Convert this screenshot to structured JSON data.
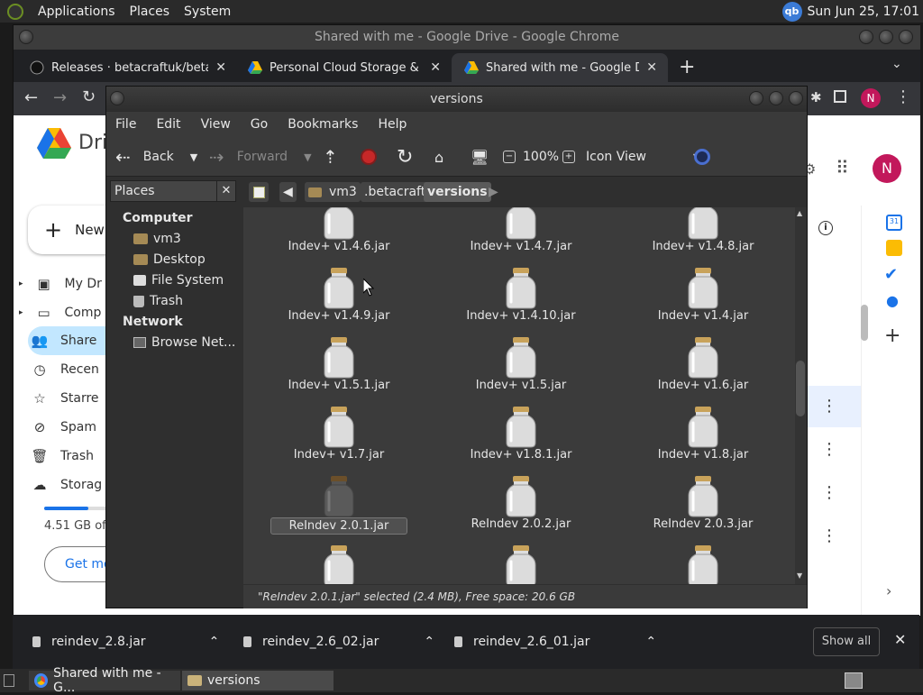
{
  "top_panel": {
    "menus": [
      "Applications",
      "Places",
      "System"
    ],
    "indicator": "qb",
    "clock": "Sun Jun 25, 17:01"
  },
  "chrome": {
    "title": "Shared with me - Google Drive - Google Chrome",
    "tabs": [
      {
        "label": "Releases · betacraftuk/betacra"
      },
      {
        "label": "Personal Cloud Storage & File"
      },
      {
        "label": "Shared with me - Google Drive"
      }
    ],
    "new_tab": "+",
    "profile_initial": "N"
  },
  "drive": {
    "logo_text": "Dri",
    "new_label": "New",
    "nav_items": [
      "My Dr",
      "Comp",
      "Share",
      "Recen",
      "Starre",
      "Spam",
      "Trash",
      "Storag"
    ],
    "storage_text": "4.51 GB of",
    "get_more": "Get mo",
    "profile_initial": "N"
  },
  "downloads": {
    "items": [
      "reindev_2.8.jar",
      "reindev_2.6_02.jar",
      "reindev_2.6_01.jar"
    ],
    "show_all": "Show all"
  },
  "taskbar": {
    "items": [
      "Shared with me - G...",
      "versions"
    ]
  },
  "caja": {
    "title": "versions",
    "menu": [
      "File",
      "Edit",
      "View",
      "Go",
      "Bookmarks",
      "Help"
    ],
    "toolbar": {
      "back": "Back",
      "forward": "Forward",
      "zoom": "100%",
      "view": "Icon View"
    },
    "places_label": "Places",
    "sidebar": {
      "computer": "Computer",
      "computer_items": [
        "vm3",
        "Desktop",
        "File System",
        "Trash"
      ],
      "network": "Network",
      "network_items": [
        "Browse Net..."
      ]
    },
    "path": [
      "vm3",
      ".betacraft",
      "versions"
    ],
    "files": [
      "Indev+ v1.4.6.jar",
      "Indev+ v1.4.7.jar",
      "Indev+ v1.4.8.jar",
      "Indev+ v1.4.9.jar",
      "Indev+ v1.4.10.jar",
      "Indev+ v1.4.jar",
      "Indev+ v1.5.1.jar",
      "Indev+ v1.5.jar",
      "Indev+ v1.6.jar",
      "Indev+ v1.7.jar",
      "Indev+ v1.8.1.jar",
      "Indev+ v1.8.jar",
      "ReIndev 2.0.1.jar",
      "ReIndev 2.0.2.jar",
      "ReIndev 2.0.3.jar"
    ],
    "selected_file": "ReIndev 2.0.1.jar",
    "status": "\"ReIndev 2.0.1.jar\" selected (2.4 MB), Free space: 20.6 GB"
  }
}
